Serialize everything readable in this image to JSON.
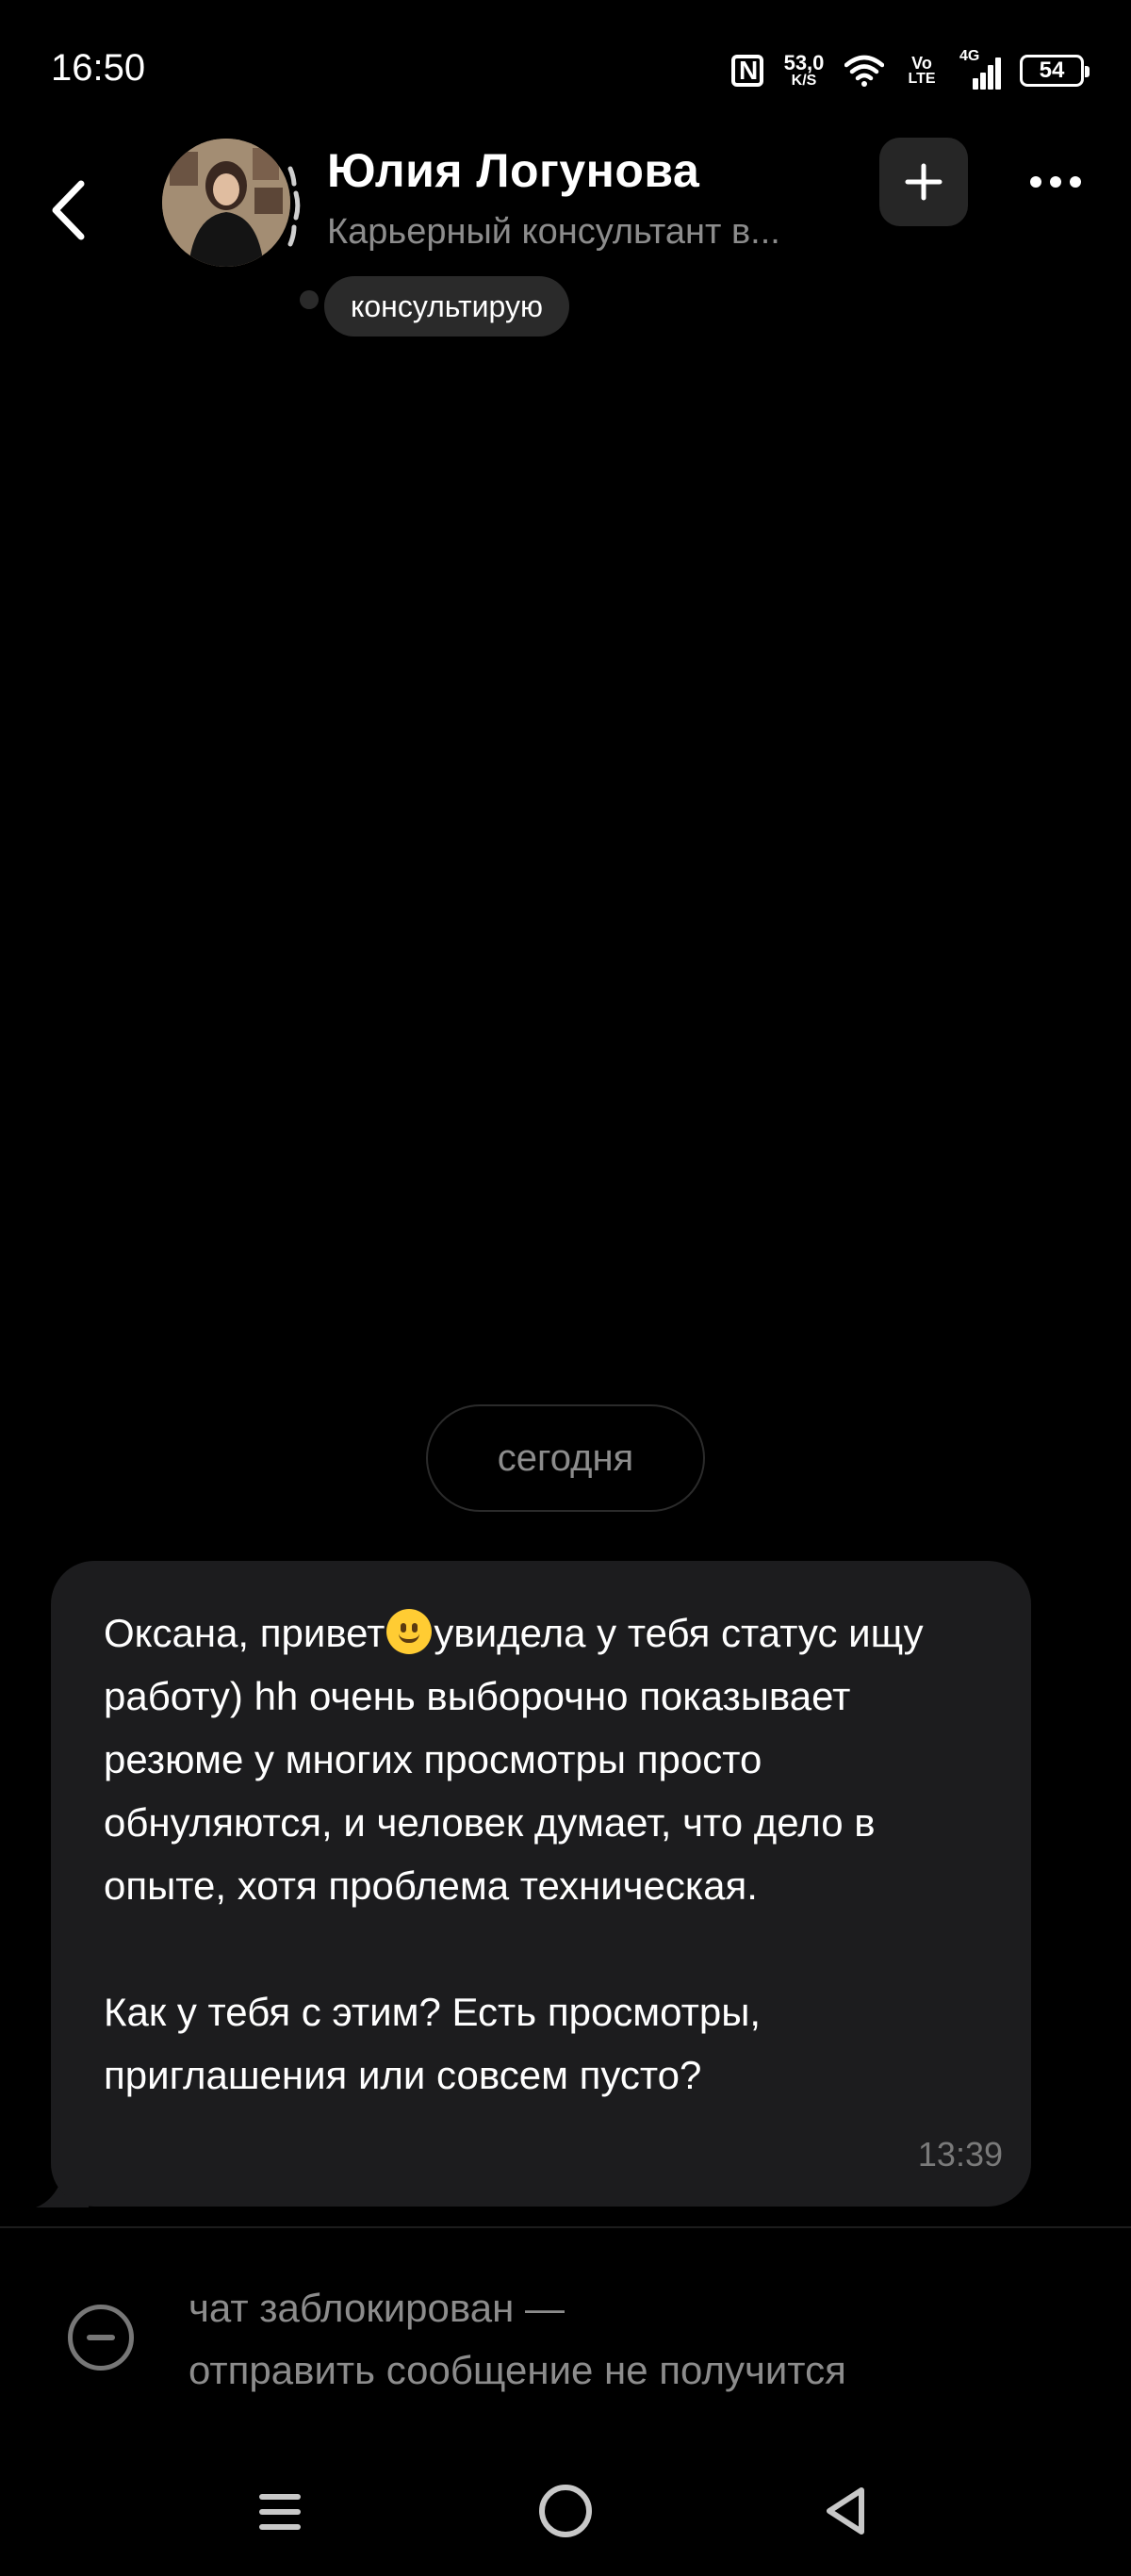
{
  "status_bar": {
    "time": "16:50",
    "net_speed_value": "53,0",
    "net_speed_unit": "K/S",
    "volte_top": "Vo",
    "volte_bottom": "LTE",
    "network_type": "4G",
    "battery_level": "54"
  },
  "header": {
    "contact_name": "Юлия Логунова",
    "contact_subtitle": "Карьерный консультант в...",
    "status_text": "консультирую"
  },
  "chat": {
    "date_label": "сегодня",
    "message": {
      "text_part1": "Оксана, привет",
      "text_part2": "увидела у тебя статус ищу работу) hh очень выборочно показывает резюме у многих просмотры просто обнуляются, и человек думает, что дело в опыте, хотя проблема техническая.\n\nКак у тебя с этим? Есть просмотры, приглашения или совсем пусто?",
      "time": "13:39"
    }
  },
  "footer": {
    "blocked_line1": "чат заблокирован —",
    "blocked_line2": "отправить сообщение не получится"
  },
  "colors": {
    "background": "#000000",
    "bubble": "#1c1c1e",
    "secondary_text": "#8c8c8c"
  },
  "icons": [
    "nfc-icon",
    "wifi-icon",
    "signal-icon",
    "battery-icon",
    "back-chevron-icon",
    "plus-icon",
    "more-dots-icon",
    "emoji-smile-icon",
    "blocked-minus-icon",
    "nav-menu-icon",
    "nav-home-icon",
    "nav-back-icon"
  ]
}
